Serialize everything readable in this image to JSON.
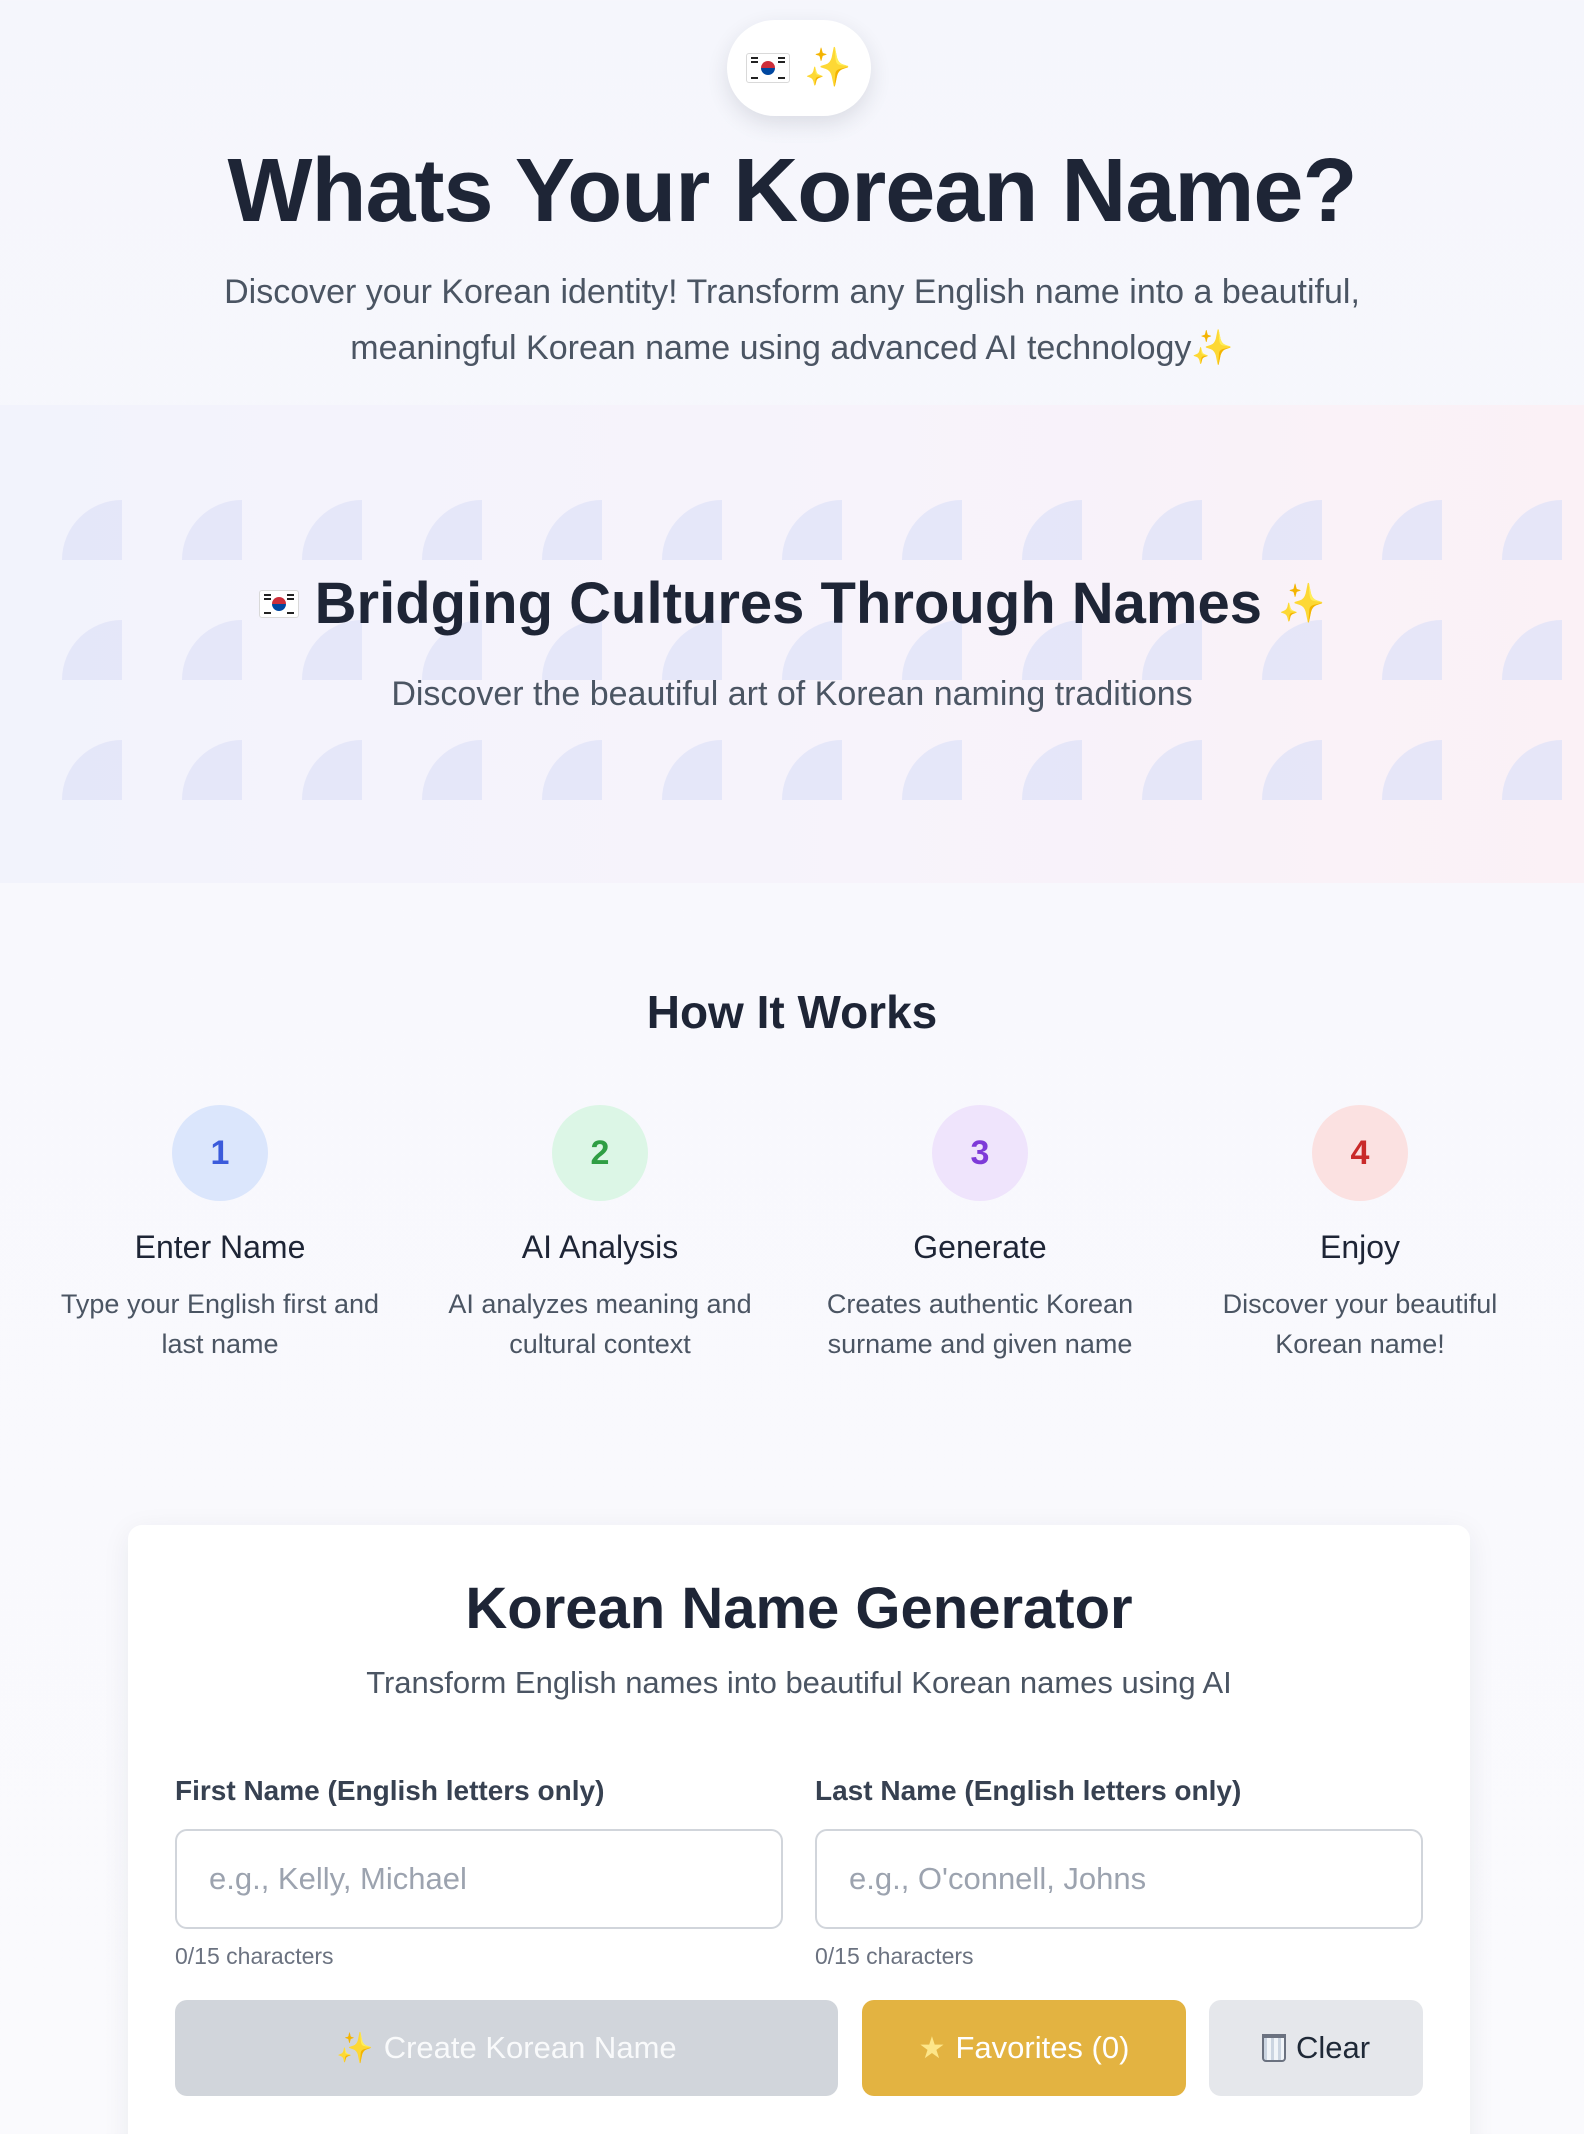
{
  "hero": {
    "title": "Whats Your Korean Name?",
    "description": "Discover your Korean identity! Transform any English name into a beautiful, meaningful Korean name using advanced AI technology✨",
    "badge_icons": [
      "korean-flag-icon",
      "sparkles-icon"
    ]
  },
  "banner": {
    "title": "Bridging Cultures Through Names",
    "subtitle": "Discover the beautiful art of Korean naming traditions"
  },
  "how_it_works": {
    "title": "How It Works",
    "steps": [
      {
        "number": "1",
        "title": "Enter Name",
        "description": "Type your English first and last name",
        "color": "#dbe6fc",
        "text_color": "#3b5bdb"
      },
      {
        "number": "2",
        "title": "AI Analysis",
        "description": "AI analyzes meaning and cultural context",
        "color": "#dcf6e6",
        "text_color": "#2f9e44"
      },
      {
        "number": "3",
        "title": "Generate",
        "description": "Creates authentic Korean surname and given name",
        "color": "#efe4fc",
        "text_color": "#7e3ad8"
      },
      {
        "number": "4",
        "title": "Enjoy",
        "description": "Discover your beautiful Korean name!",
        "color": "#fbe1e1",
        "text_color": "#c92a2a"
      }
    ]
  },
  "generator": {
    "title": "Korean Name Generator",
    "subtitle": "Transform English names into beautiful Korean names using AI",
    "first_name": {
      "label": "First Name (English letters only)",
      "placeholder": "e.g., Kelly, Michael",
      "value": "",
      "counter": "0/15 characters"
    },
    "last_name": {
      "label": "Last Name (English letters only)",
      "placeholder": "e.g., O'connell, Johns",
      "value": "",
      "counter": "0/15 characters"
    },
    "buttons": {
      "create": "Create Korean Name",
      "favorites": "Favorites (0)",
      "clear": "Clear"
    }
  }
}
